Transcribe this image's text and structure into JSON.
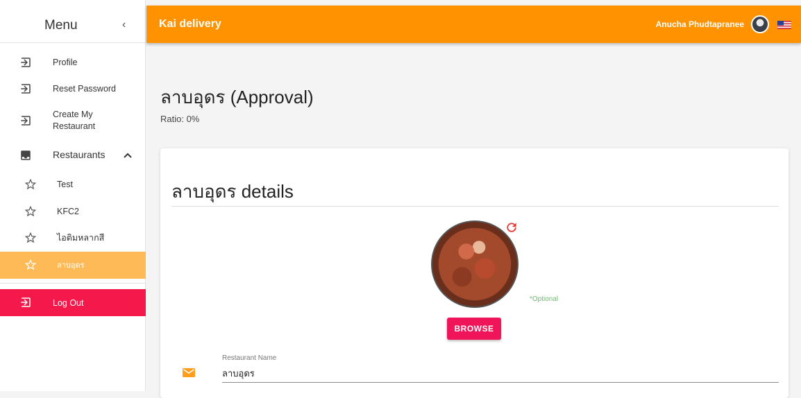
{
  "sidebar": {
    "title": "Menu",
    "collapse_icon": "chevron-left-icon",
    "items": [
      {
        "label": "Profile",
        "icon": "login-arrow-icon"
      },
      {
        "label": "Reset Password",
        "icon": "login-arrow-icon"
      },
      {
        "label": "Create My Restaurant",
        "icon": "login-arrow-icon"
      },
      {
        "label": "Restaurants",
        "icon": "tray-download-icon",
        "expanded": true
      }
    ],
    "restaurants": [
      {
        "label": "Test",
        "icon": "star-icon"
      },
      {
        "label": "KFC2",
        "icon": "star-icon"
      },
      {
        "label": "ไอติมหลากสี",
        "icon": "star-icon"
      },
      {
        "label": "ลาบอุดร",
        "icon": "star-icon",
        "active": true
      }
    ],
    "logout": {
      "label": "Log Out",
      "icon": "login-arrow-icon"
    }
  },
  "appbar": {
    "title": "Kai delivery",
    "user_name": "Anucha Phudtapranee",
    "language_flag": "us-flag-icon"
  },
  "page": {
    "title": "ลาบอุดร (Approval)",
    "ratio": "Ratio: 0%"
  },
  "card": {
    "title": "ลาบอุดร details",
    "optional_note": "*Optional",
    "browse_label": "BROWSE",
    "restaurant_name_label": "Restaurant Name",
    "restaurant_name_value": "ลาบอุดร"
  },
  "colors": {
    "appbar": "#ff9200",
    "active_item": "#ffba58",
    "logout": "#f5184a",
    "browse_button": "#f0145a",
    "optional_text": "#6dbb6d"
  }
}
